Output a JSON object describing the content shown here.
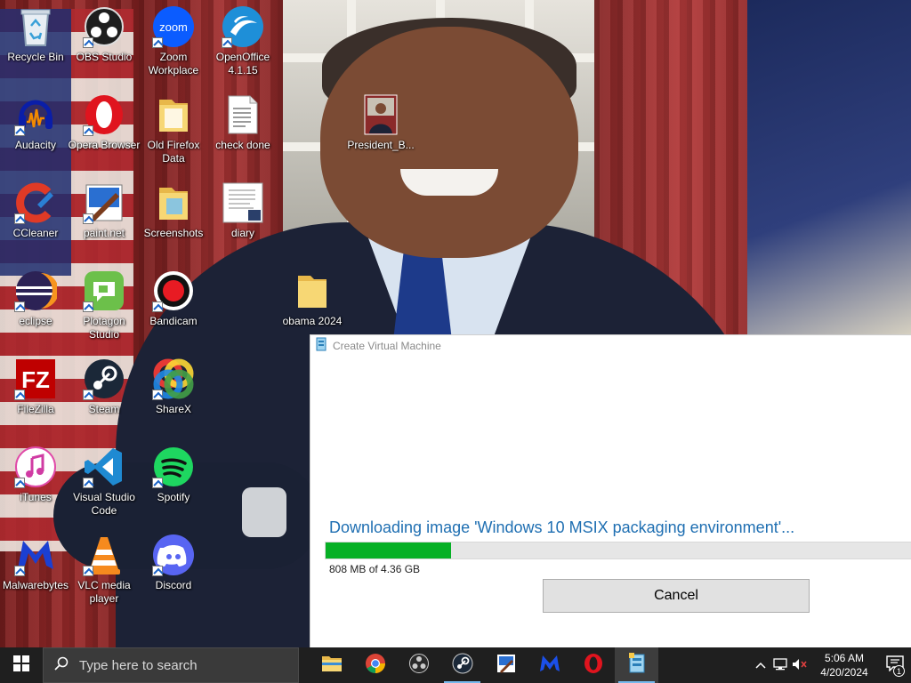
{
  "desktop": {
    "icons": [
      {
        "label": "Recycle Bin",
        "icon": "recycle-bin-icon"
      },
      {
        "label": "OBS Studio",
        "icon": "obs-studio-icon"
      },
      {
        "label": "Zoom Workplace",
        "icon": "zoom-icon"
      },
      {
        "label": "OpenOffice 4.1.15",
        "icon": "openoffice-icon"
      },
      {
        "label": "Audacity",
        "icon": "audacity-icon"
      },
      {
        "label": "Opera Browser",
        "icon": "opera-icon"
      },
      {
        "label": "Old Firefox Data",
        "icon": "folder-icon"
      },
      {
        "label": "check done",
        "icon": "text-file-icon"
      },
      {
        "label": "President_B...",
        "icon": "image-file-icon"
      },
      {
        "label": "CCleaner",
        "icon": "ccleaner-icon"
      },
      {
        "label": "paint.net",
        "icon": "paintnet-icon"
      },
      {
        "label": "Screenshots",
        "icon": "folder-icon"
      },
      {
        "label": "diary",
        "icon": "document-icon"
      },
      {
        "label": "eclipse",
        "icon": "eclipse-icon"
      },
      {
        "label": "Plotagon Studio",
        "icon": "plotagon-icon"
      },
      {
        "label": "Bandicam",
        "icon": "bandicam-icon"
      },
      {
        "label": "obama 2024",
        "icon": "folder-icon"
      },
      {
        "label": "FileZilla",
        "icon": "filezilla-icon"
      },
      {
        "label": "Steam",
        "icon": "steam-icon"
      },
      {
        "label": "ShareX",
        "icon": "sharex-icon"
      },
      {
        "label": "iTunes",
        "icon": "itunes-icon"
      },
      {
        "label": "Visual Studio Code",
        "icon": "vscode-icon"
      },
      {
        "label": "Spotify",
        "icon": "spotify-icon"
      },
      {
        "label": "Malwarebytes",
        "icon": "malwarebytes-icon"
      },
      {
        "label": "VLC media player",
        "icon": "vlc-icon"
      },
      {
        "label": "Discord",
        "icon": "discord-icon"
      }
    ]
  },
  "dialog": {
    "title": "Create Virtual Machine",
    "message": "Downloading image 'Windows 10 MSIX packaging environment'...",
    "progress_fraction": 0.215,
    "size_text": "808 MB of 4.36 GB",
    "cancel_label": "Cancel"
  },
  "taskbar": {
    "search_placeholder": "Type here to search",
    "apps": [
      {
        "name": "File Explorer",
        "icon": "file-explorer-icon",
        "state": "normal"
      },
      {
        "name": "Google Chrome",
        "icon": "chrome-icon",
        "state": "normal"
      },
      {
        "name": "OBS Studio",
        "icon": "obs-studio-icon",
        "state": "normal"
      },
      {
        "name": "Steam",
        "icon": "steam-icon",
        "state": "open"
      },
      {
        "name": "paint.net",
        "icon": "paintnet-icon",
        "state": "normal"
      },
      {
        "name": "Malwarebytes",
        "icon": "malwarebytes-icon",
        "state": "normal"
      },
      {
        "name": "Opera",
        "icon": "opera-icon",
        "state": "normal"
      },
      {
        "name": "Hyper-V Quick Create",
        "icon": "hyperv-icon",
        "state": "active"
      }
    ],
    "clock_time": "5:06 AM",
    "clock_date": "4/20/2024",
    "notification_count": "1"
  },
  "colors": {
    "progress_green": "#06b025",
    "message_blue": "#1f6fb2",
    "taskbar_bg": "#1f1f1f"
  }
}
